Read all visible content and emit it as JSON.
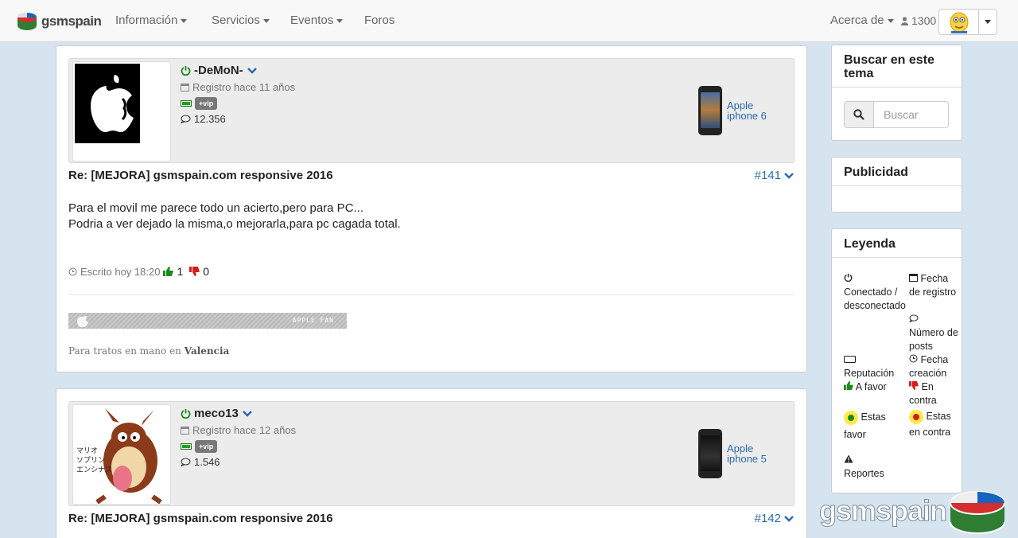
{
  "nav": {
    "brand": "gsmspain",
    "items": [
      {
        "label": "Información",
        "caret": true
      },
      {
        "label": "Servicios",
        "caret": true
      },
      {
        "label": "Eventos",
        "caret": true
      },
      {
        "label": "Foros",
        "caret": false
      }
    ],
    "about": "Acerca de",
    "user_count": "1300"
  },
  "posts": [
    {
      "user": "-DeMoN-",
      "registered": "Registro hace 11 años",
      "badge": "+vip",
      "post_count": "12.356",
      "device": {
        "brand": "Apple",
        "model": "iphone 6"
      },
      "title": "Re: [MEJORA] gsmspain.com responsive 2016",
      "number": "#141",
      "body": [
        "Para el movil me parece todo un acierto,pero para PC...",
        "Podria a ver dejado la misma,o mejorarla,para pc cagada total."
      ],
      "written": "Escrito hoy 18:20",
      "likes": "1",
      "dislikes": "0",
      "signature_banner": "APPLE FAN",
      "signature_prefix": "Para tratos en mano en",
      "signature_city": "Valencia"
    },
    {
      "user": "meco13",
      "registered": "Registro hace 12 años",
      "badge": "+vip",
      "post_count": "1.546",
      "device": {
        "brand": "Apple",
        "model": "iphone 5"
      },
      "title": "Re: [MEJORA] gsmspain.com responsive 2016",
      "number": "#142",
      "avatar_caption": [
        "マリオ",
        "ソプリン",
        "エンシナス"
      ]
    }
  ],
  "sidebar": {
    "search": {
      "title": "Buscar en este tema",
      "placeholder": "Buscar"
    },
    "ads": {
      "title": "Publicidad"
    },
    "legend": {
      "title": "Leyenda",
      "online": "Conectado / desconectado",
      "reg_date": "Fecha de registro",
      "num_posts": "Número de posts",
      "reputation": "Reputación",
      "created": "Fecha creación",
      "in_favor": "A favor",
      "against": "En contra",
      "you_favor": "Estas favor",
      "you_against": "Estas en contra",
      "reports": "Reportes"
    }
  },
  "watermark": "gsmspain",
  "colors": {
    "link": "#2a6ab0",
    "online": "#1a8a1a",
    "like": "#1a8a1a",
    "dislike": "#d61b1b",
    "page_bg": "#d6e4ef"
  }
}
